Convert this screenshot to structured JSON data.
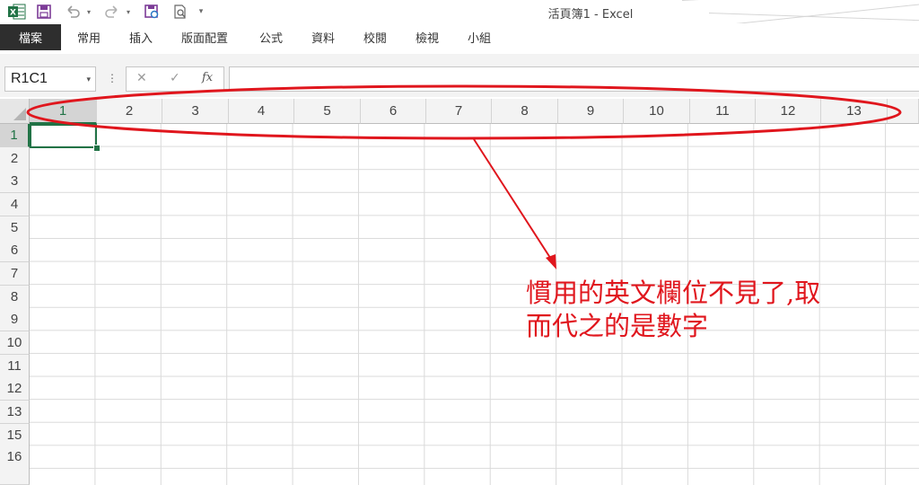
{
  "window": {
    "title": "活頁簿1 - Excel"
  },
  "quick_access": {
    "more": "▾"
  },
  "ribbon": {
    "file_tab": "檔案",
    "tabs": [
      "常用",
      "插入",
      "版面配置",
      "公式",
      "資料",
      "校閱",
      "檢視",
      "小組"
    ]
  },
  "formula_bar": {
    "name_box": "R1C1",
    "name_box_arrow": "▾",
    "dots": "⋮",
    "cancel": "✕",
    "enter": "✓",
    "fx": "fx",
    "formula": ""
  },
  "sheet": {
    "columns": [
      "1",
      "2",
      "3",
      "4",
      "5",
      "6",
      "7",
      "8",
      "9",
      "10",
      "11",
      "12",
      "13",
      "1"
    ],
    "rows": [
      "1",
      "2",
      "3",
      "4",
      "5",
      "6",
      "7",
      "8",
      "9",
      "10",
      "11",
      "12",
      "13",
      "15",
      "16"
    ],
    "active_cell": "R1C1"
  },
  "annotation": {
    "line1": "慣用的英文欄位不見了,取",
    "line2": "而代之的是數字",
    "color": "#e0161d"
  },
  "colors": {
    "excel_green": "#217346",
    "file_tab_bg": "#2e2e2e",
    "header_bg": "#f3f3f3",
    "gridline": "#dadada"
  }
}
